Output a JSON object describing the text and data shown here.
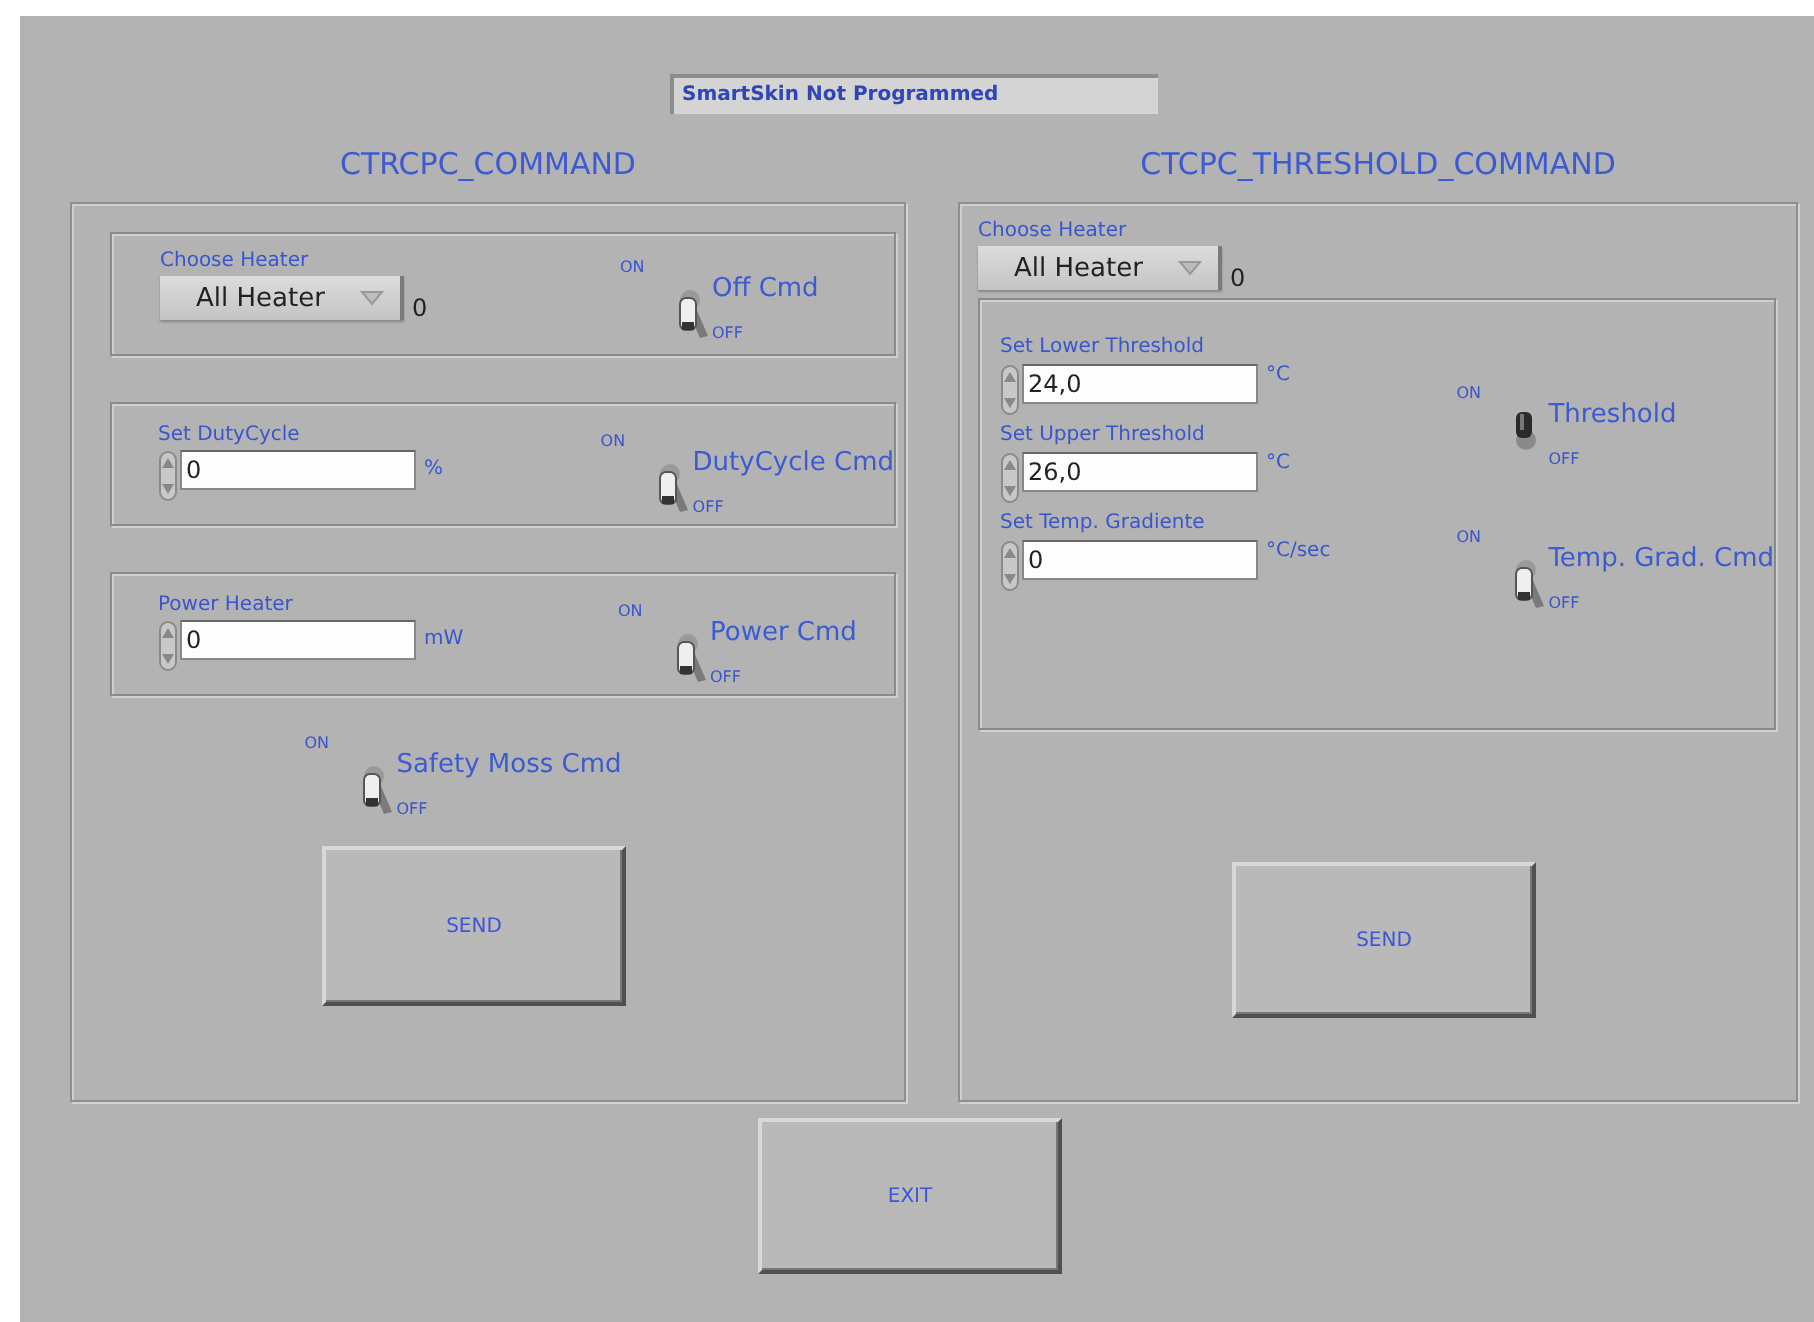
{
  "status": "SmartSkin Not Programmed",
  "panels": [
    {
      "kind": "command",
      "title": "CTRCPC_COMMAND",
      "groups": [
        {
          "kind": "dropdown",
          "label": "Choose Heater",
          "value": "All Heater",
          "index": "0",
          "toggle": {
            "on_label": "ON",
            "off_label": "OFF",
            "on": false,
            "name": "Off Cmd"
          }
        },
        {
          "kind": "numeric",
          "label": "Set DutyCycle",
          "value": "0",
          "unit": "%",
          "toggle": {
            "on_label": "ON",
            "off_label": "OFF",
            "on": false,
            "name": "DutyCycle Cmd"
          }
        },
        {
          "kind": "numeric",
          "label": "Power Heater",
          "value": "0",
          "unit": "mW",
          "toggle": {
            "on_label": "ON",
            "off_label": "OFF",
            "on": false,
            "name": "Power Cmd"
          }
        }
      ],
      "extra_toggle": {
        "on_label": "ON",
        "off_label": "OFF",
        "on": false,
        "name": "Safety Moss Cmd"
      },
      "button": "SEND"
    },
    {
      "kind": "threshold",
      "title": "CTCPC_THRESHOLD_COMMAND",
      "heater": {
        "label": "Choose Heater",
        "value": "All Heater",
        "index": "0"
      },
      "fields": [
        {
          "label": "Set Lower Threshold",
          "value": "24,0",
          "unit": "°C"
        },
        {
          "label": "Set Upper Threshold",
          "value": "26,0",
          "unit": "°C"
        },
        {
          "label": "Set Temp. Gradiente",
          "value": "0",
          "unit": "°C/sec"
        }
      ],
      "toggles": [
        {
          "on_label": "ON",
          "off_label": "OFF",
          "on": true,
          "name": "Threshold"
        },
        {
          "on_label": "ON",
          "off_label": "OFF",
          "on": false,
          "name": "Temp. Grad. Cmd"
        }
      ],
      "button": "SEND"
    }
  ],
  "exit_button": "EXIT"
}
